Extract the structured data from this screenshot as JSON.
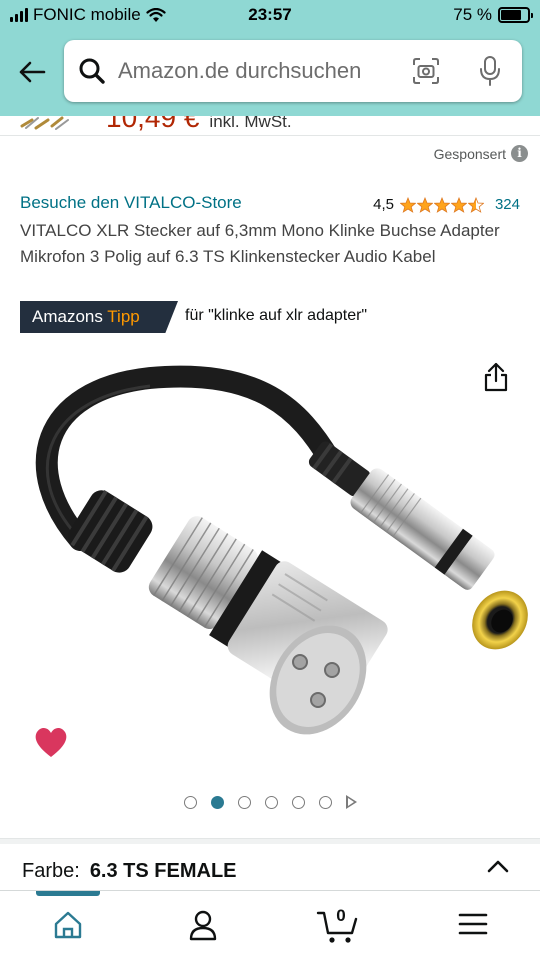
{
  "status_bar": {
    "carrier": "FONIC mobile",
    "time": "23:57",
    "battery_percent": "75 %",
    "battery_level": 0.75
  },
  "search": {
    "placeholder": "Amazon.de durchsuchen"
  },
  "price_strip": {
    "price": "10,49 €",
    "tax_note": "inkl. MwSt."
  },
  "sponsored": {
    "label": "Gesponsert",
    "info_glyph": "i"
  },
  "product": {
    "store_link": "Besuche den VITALCO-Store",
    "rating_value": "4,5",
    "rating_stars": 4.5,
    "rating_count": "324",
    "title": "VITALCO XLR Stecker auf 6,3mm Mono Klinke Buchse Adapter Mikrofon 3 Polig auf 6.3 TS Klinkenstecker Audio Kabel",
    "badge_prefix": "Amazons",
    "badge_highlight": "Tipp",
    "badge_query": "für \"klinke auf xlr adapter\"",
    "image_count": 6,
    "active_image_index": 1,
    "color_label": "Farbe:",
    "color_value": "6.3 TS FEMALE"
  },
  "bottom_nav": {
    "cart_count": "0",
    "items": [
      "home-icon",
      "account-icon",
      "cart-icon",
      "menu-icon"
    ]
  },
  "colors": {
    "header_bg": "#8fd8d3",
    "link": "#007185",
    "price": "#b12704",
    "star": "#ffa41c",
    "badge_bg": "#232f3e",
    "badge_accent": "#ff9900",
    "heart": "#d9365e",
    "active_nav": "#2b7a92"
  }
}
